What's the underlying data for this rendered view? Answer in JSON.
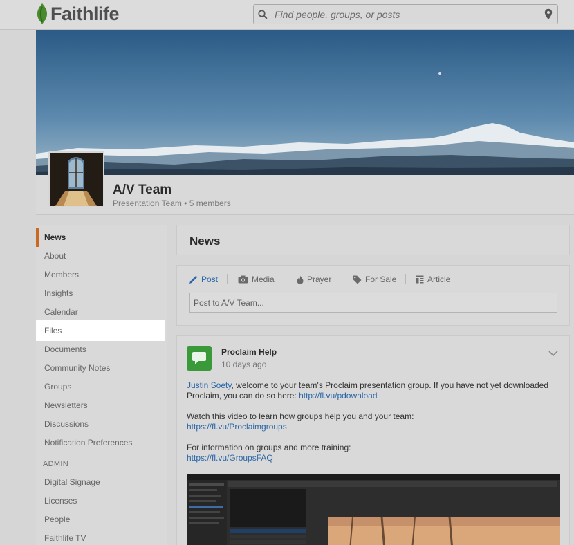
{
  "brand": {
    "name": "Faithlife"
  },
  "search": {
    "placeholder": "Find people, groups, or posts"
  },
  "group": {
    "name": "A/V Team",
    "subtitle": "Presentation Team • 5 members"
  },
  "sidebar": {
    "items": [
      {
        "label": "News"
      },
      {
        "label": "About"
      },
      {
        "label": "Members"
      },
      {
        "label": "Insights"
      },
      {
        "label": "Calendar"
      },
      {
        "label": "Files"
      },
      {
        "label": "Documents"
      },
      {
        "label": "Community Notes"
      },
      {
        "label": "Groups"
      },
      {
        "label": "Newsletters"
      },
      {
        "label": "Discussions"
      },
      {
        "label": "Notification Preferences"
      }
    ],
    "admin_header": "ADMIN",
    "admin_items": [
      {
        "label": "Digital Signage"
      },
      {
        "label": "Licenses"
      },
      {
        "label": "People"
      },
      {
        "label": "Faithlife TV"
      }
    ]
  },
  "news": {
    "title": "News"
  },
  "composer": {
    "tabs": [
      {
        "label": "Post",
        "icon": "pencil-icon"
      },
      {
        "label": "Media",
        "icon": "camera-icon"
      },
      {
        "label": "Prayer",
        "icon": "flame-icon"
      },
      {
        "label": "For Sale",
        "icon": "tag-icon"
      },
      {
        "label": "Article",
        "icon": "article-icon"
      }
    ],
    "placeholder": "Post to A/V Team..."
  },
  "post": {
    "author": "Proclaim Help",
    "time": "10 days ago",
    "user_link": "Justin Soety",
    "p1_text": ", welcome to your team's Proclaim presentation group. If you have not yet downloaded Proclaim, you can do so here: ",
    "p1_link": "http://fl.vu/pdownload",
    "p2_text": "Watch this video to learn how groups help you and your team:",
    "p2_link": "https://fl.vu/Proclaimgroups",
    "p3_text": "For information on groups and more training:",
    "p3_link": "https://fl.vu/GroupsFAQ"
  },
  "colors": {
    "accent": "#c86a22",
    "link": "#2b67a8",
    "app_icon": "#3a9a3a"
  }
}
